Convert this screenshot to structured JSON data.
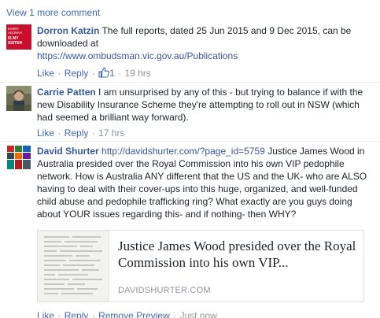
{
  "view_more": "View 1 more comment",
  "comments": [
    {
      "author": "Dorron Katzin",
      "text_before": " The full reports, dated 25 Jun 2015 and 9 Dec 2015, can be downloaded at",
      "link": "https://www.ombudsman.vic.gov.au/Publications",
      "like": "Like",
      "reply": "Reply",
      "like_count": "1",
      "time": "19 hrs",
      "avatar_lines": [
        "EVERY",
        "ADUNAH",
        "IS MY",
        "SISTER"
      ],
      "avatar_color": "#c8102e"
    },
    {
      "author": "Carrie Patten",
      "text": " I am unsurprised by any of this - but trying to balance if with the new Disability Insurance Scheme they're attempting to roll out in NSW (which had seemed a brilliant way forward).",
      "like": "Like",
      "reply": "Reply",
      "time": "17 hrs"
    },
    {
      "author": "David Shurter",
      "link": "http://davidshurter.com/?page_id=5759",
      "text_after": " Justice James Wood in Australia presided over the Royal Commission into his own VIP pedophile network. How is Australia ANY different that the US and the UK- who are ALSO having to deal with their cover-ups into this huge, organized, and well-funded child abuse and pedophile trafficking ring? What exactly are you guys doing about YOUR issues regarding this- and if nothing- then WHY?",
      "preview": {
        "title": "Justice James Wood presided over the Royal Commission into his own VIP...",
        "domain": "DAVIDSHURTER.COM"
      },
      "like": "Like",
      "reply": "Reply",
      "remove_preview": "Remove Preview",
      "time": "Just now"
    }
  ],
  "colors": {
    "link": "#365899",
    "action": "#4267b2",
    "meta": "#90949c",
    "text": "#1d2129"
  }
}
